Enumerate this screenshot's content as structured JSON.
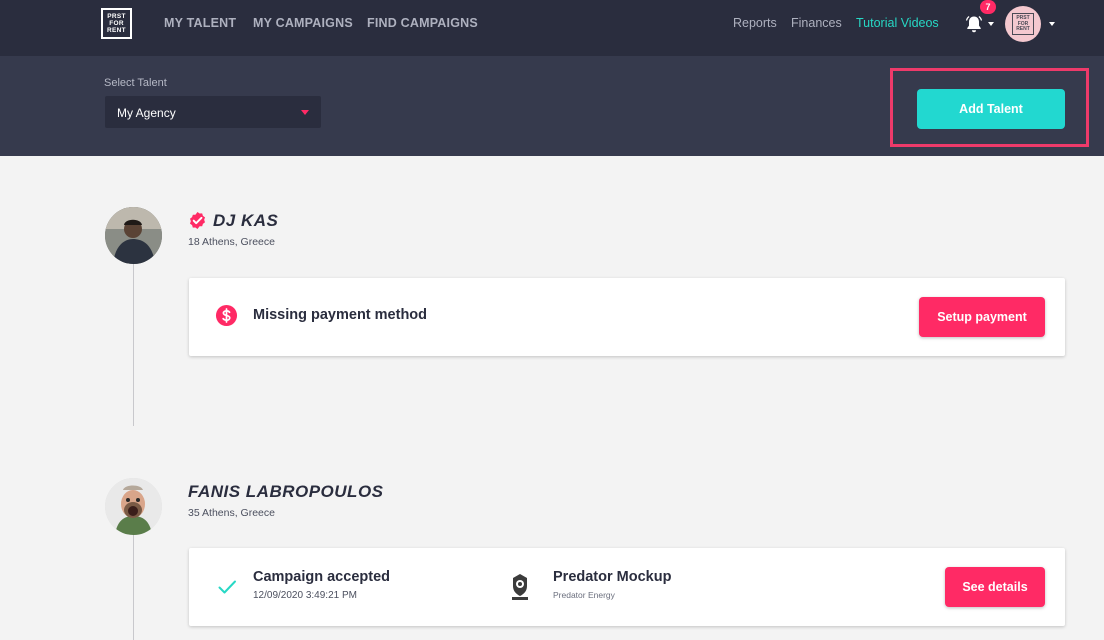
{
  "header": {
    "logo_lines": [
      "PRST",
      "FOR",
      "RENT"
    ],
    "nav": [
      "MY TALENT",
      "MY CAMPAIGNS",
      "FIND CAMPAIGNS"
    ],
    "right_links": [
      "Reports",
      "Finances",
      "Tutorial Videos"
    ],
    "notifications_count": "7",
    "accent_color": "#27d8c5"
  },
  "toolbar": {
    "select_label": "Select Talent",
    "select_value": "My Agency",
    "add_talent_label": "Add Talent"
  },
  "talents": [
    {
      "name": "DJ KAS",
      "meta": "18 Athens, Greece",
      "verified": true,
      "card": {
        "icon": "dollar-icon",
        "title": "Missing payment method",
        "button_label": "Setup payment"
      }
    },
    {
      "name": "FANIS LABROPOULOS",
      "meta": "35 Athens, Greece",
      "verified": false,
      "card": {
        "icon": "check-icon",
        "status_title": "Campaign accepted",
        "status_time": "12/09/2020 3:49:21 PM",
        "campaign_title": "Predator Mockup",
        "campaign_brand": "Predator Energy",
        "button_label": "See details"
      }
    }
  ],
  "colors": {
    "nav_bg": "#2a2d3e",
    "subbar_bg": "#363a4d",
    "teal": "#22d8d0",
    "pink": "#ff2a65"
  }
}
